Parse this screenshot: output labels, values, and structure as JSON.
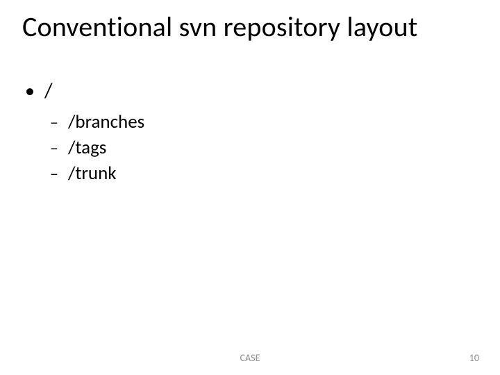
{
  "title": "Conventional svn repository layout",
  "bullets": {
    "root": "/",
    "children": [
      "/branches",
      "/tags",
      "/trunk"
    ]
  },
  "markers": {
    "l1": "•",
    "l2": "–"
  },
  "footer": {
    "center": "CASE",
    "page": "10"
  }
}
